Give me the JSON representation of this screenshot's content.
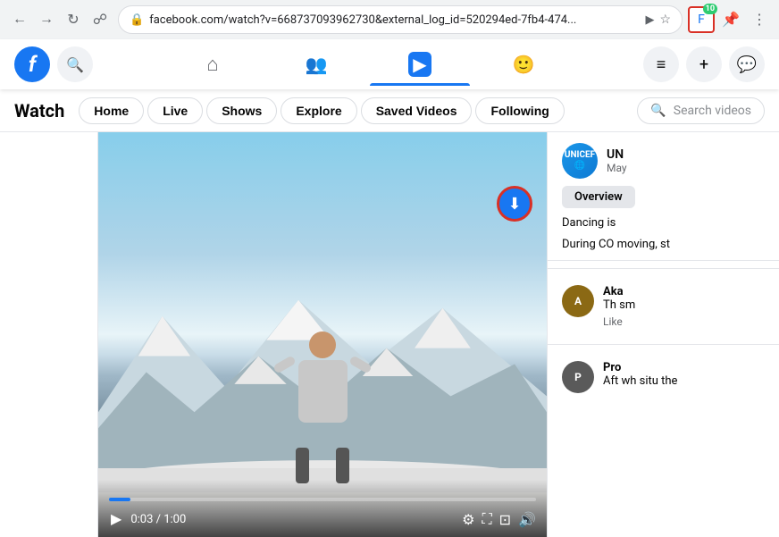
{
  "browser": {
    "back_disabled": false,
    "forward_disabled": false,
    "url": "facebook.com/watch?v=668737093962730&external_log_id=520294ed-7fb4-474...",
    "ext_badge": "10"
  },
  "fb_header": {
    "logo_letter": "f",
    "nav_items": [
      {
        "label": "Home",
        "icon": "⌂",
        "active": false
      },
      {
        "label": "People",
        "icon": "👥",
        "active": false
      },
      {
        "label": "Watch",
        "icon": "▶",
        "active": true
      },
      {
        "label": "Groups",
        "icon": "🙂",
        "active": false
      }
    ],
    "menu_icon": "≡",
    "add_icon": "+",
    "messenger_icon": "💬"
  },
  "watch_nav": {
    "title": "Watch",
    "items": [
      {
        "label": "Home"
      },
      {
        "label": "Live"
      },
      {
        "label": "Shows"
      },
      {
        "label": "Explore"
      },
      {
        "label": "Saved Videos"
      },
      {
        "label": "Following"
      }
    ],
    "search_placeholder": "Search videos"
  },
  "video": {
    "time_current": "0:03",
    "time_total": "1:00",
    "download_button_label": "⬇"
  },
  "side_panel": {
    "channel": {
      "name": "UN",
      "meta": "May"
    },
    "overview_btn": "Overview",
    "description": "Dancing is",
    "description2": "During CO moving, st",
    "comments": [
      {
        "avatar_color": "#8B6914",
        "avatar_letter": "A",
        "name": "Aka",
        "text": "Th sm",
        "action": "Like"
      },
      {
        "avatar_color": "#5a5a5a",
        "avatar_letter": "P",
        "name": "Pro",
        "text": "Aft wh situ the",
        "action": ""
      }
    ]
  }
}
